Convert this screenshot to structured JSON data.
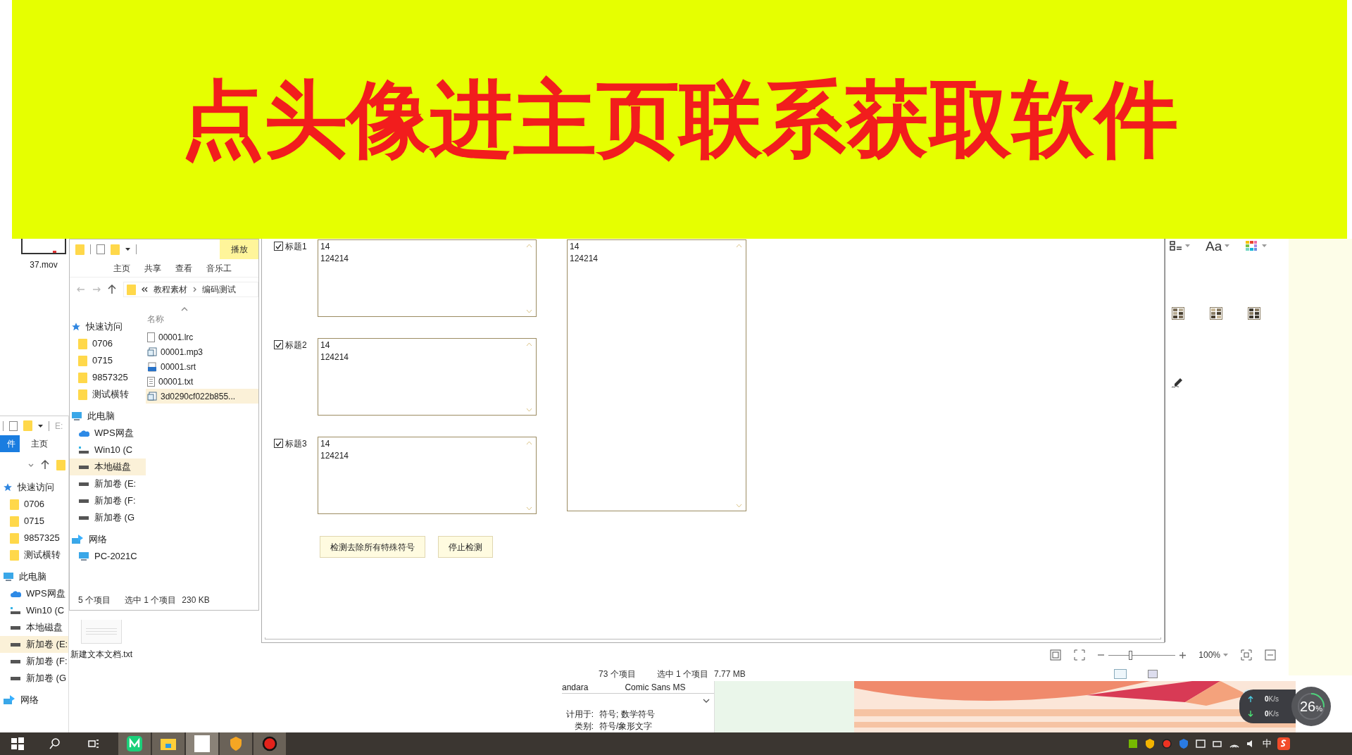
{
  "banner": {
    "text": "点头像进主页联系获取软件"
  },
  "desktop_icons": [
    {
      "label": "37.mov",
      "kind": "video"
    },
    {
      "label": "新建文本文档.txt",
      "kind": "text"
    }
  ],
  "back_explorer": {
    "address": "E:",
    "tabs": [
      {
        "label": "件",
        "selected": true
      },
      {
        "label": "主页",
        "selected": false
      }
    ],
    "nav": [
      {
        "label": "快速访问",
        "kind": "star",
        "selected": false,
        "children": [
          {
            "label": "0706",
            "kind": "folder",
            "selected": false
          },
          {
            "label": "0715",
            "kind": "folder",
            "selected": false
          },
          {
            "label": "9857325",
            "kind": "folder",
            "selected": false
          },
          {
            "label": "测试横转",
            "kind": "folder",
            "selected": false
          }
        ]
      },
      {
        "label": "此电脑",
        "kind": "pc",
        "selected": false,
        "children": [
          {
            "label": "WPS网盘",
            "kind": "cloud",
            "selected": false
          },
          {
            "label": "Win10 (C",
            "kind": "win",
            "selected": false
          },
          {
            "label": "本地磁盘",
            "kind": "drive",
            "selected": false
          },
          {
            "label": "新加卷 (E:",
            "kind": "drive",
            "selected": true
          },
          {
            "label": "新加卷 (F:",
            "kind": "drive",
            "selected": false
          },
          {
            "label": "新加卷 (G",
            "kind": "drive",
            "selected": false
          }
        ]
      },
      {
        "label": "网络",
        "kind": "network",
        "selected": false
      }
    ]
  },
  "front_explorer": {
    "context_tab": "播放",
    "tabs": [
      {
        "label": "主页"
      },
      {
        "label": "共享"
      },
      {
        "label": "查看"
      },
      {
        "label": "音乐工"
      }
    ],
    "breadcrumb": [
      "教程素材",
      "编码测试"
    ],
    "nav": [
      {
        "label": "快速访问",
        "kind": "star",
        "selected": false,
        "children": [
          {
            "label": "0706",
            "kind": "folder",
            "selected": false
          },
          {
            "label": "0715",
            "kind": "folder",
            "selected": false
          },
          {
            "label": "9857325",
            "kind": "folder",
            "selected": false
          },
          {
            "label": "测试横转",
            "kind": "folder",
            "selected": false
          }
        ]
      },
      {
        "label": "此电脑",
        "kind": "pc",
        "selected": false,
        "children": [
          {
            "label": "WPS网盘",
            "kind": "cloud",
            "selected": false
          },
          {
            "label": "Win10 (C",
            "kind": "win",
            "selected": false
          },
          {
            "label": "本地磁盘",
            "kind": "drive",
            "selected": true
          },
          {
            "label": "新加卷 (E:",
            "kind": "drive",
            "selected": false
          },
          {
            "label": "新加卷 (F:",
            "kind": "drive",
            "selected": false
          },
          {
            "label": "新加卷 (G",
            "kind": "drive",
            "selected": false
          }
        ]
      },
      {
        "label": "网络",
        "kind": "network",
        "selected": false,
        "children": [
          {
            "label": "PC-2021C",
            "kind": "monitor",
            "selected": false
          }
        ]
      }
    ],
    "column_header": "名称",
    "files": [
      {
        "name": "00001.lrc",
        "kind": "blank",
        "selected": false
      },
      {
        "name": "00001.mp3",
        "kind": "media",
        "selected": false
      },
      {
        "name": "00001.srt",
        "kind": "srt",
        "selected": false
      },
      {
        "name": "00001.txt",
        "kind": "text",
        "selected": false
      },
      {
        "name": "3d0290cf022b855...",
        "kind": "media",
        "selected": true
      }
    ],
    "status": [
      "5 个项目",
      "选中 1 个项目",
      "230 KB"
    ]
  },
  "app": {
    "fields": [
      {
        "label": "标题1",
        "checked": true,
        "lines": [
          "14",
          "124214"
        ]
      },
      {
        "label": "标题2",
        "checked": true,
        "lines": [
          "14",
          "124214"
        ]
      },
      {
        "label": "标题3",
        "checked": true,
        "lines": [
          "14",
          "124214"
        ]
      }
    ],
    "output_lines": [
      "14",
      "124214"
    ],
    "buttons": [
      "检测去除所有特殊符号",
      "停止检测"
    ]
  },
  "style_panel": {
    "font_button": "Aa"
  },
  "zoom_bar": {
    "zoom": "100%",
    "level": 0.32
  },
  "explorer_status": [
    "73 个项目",
    "选中 1 个项目",
    "7.77 MB"
  ],
  "font_viewer": {
    "fonts": [
      "andara",
      "Comic Sans MS"
    ],
    "info": [
      {
        "label": "计用于:",
        "value": "符号; 数学符号"
      },
      {
        "label": "类别:",
        "value": "符号/象形文字"
      }
    ]
  },
  "net_monitor": {
    "up": "0",
    "up_unit": "K/s",
    "down": "0",
    "down_unit": "K/s",
    "cpu": "26",
    "cpu_unit": "%"
  },
  "taskbar": {
    "ime": "中"
  }
}
